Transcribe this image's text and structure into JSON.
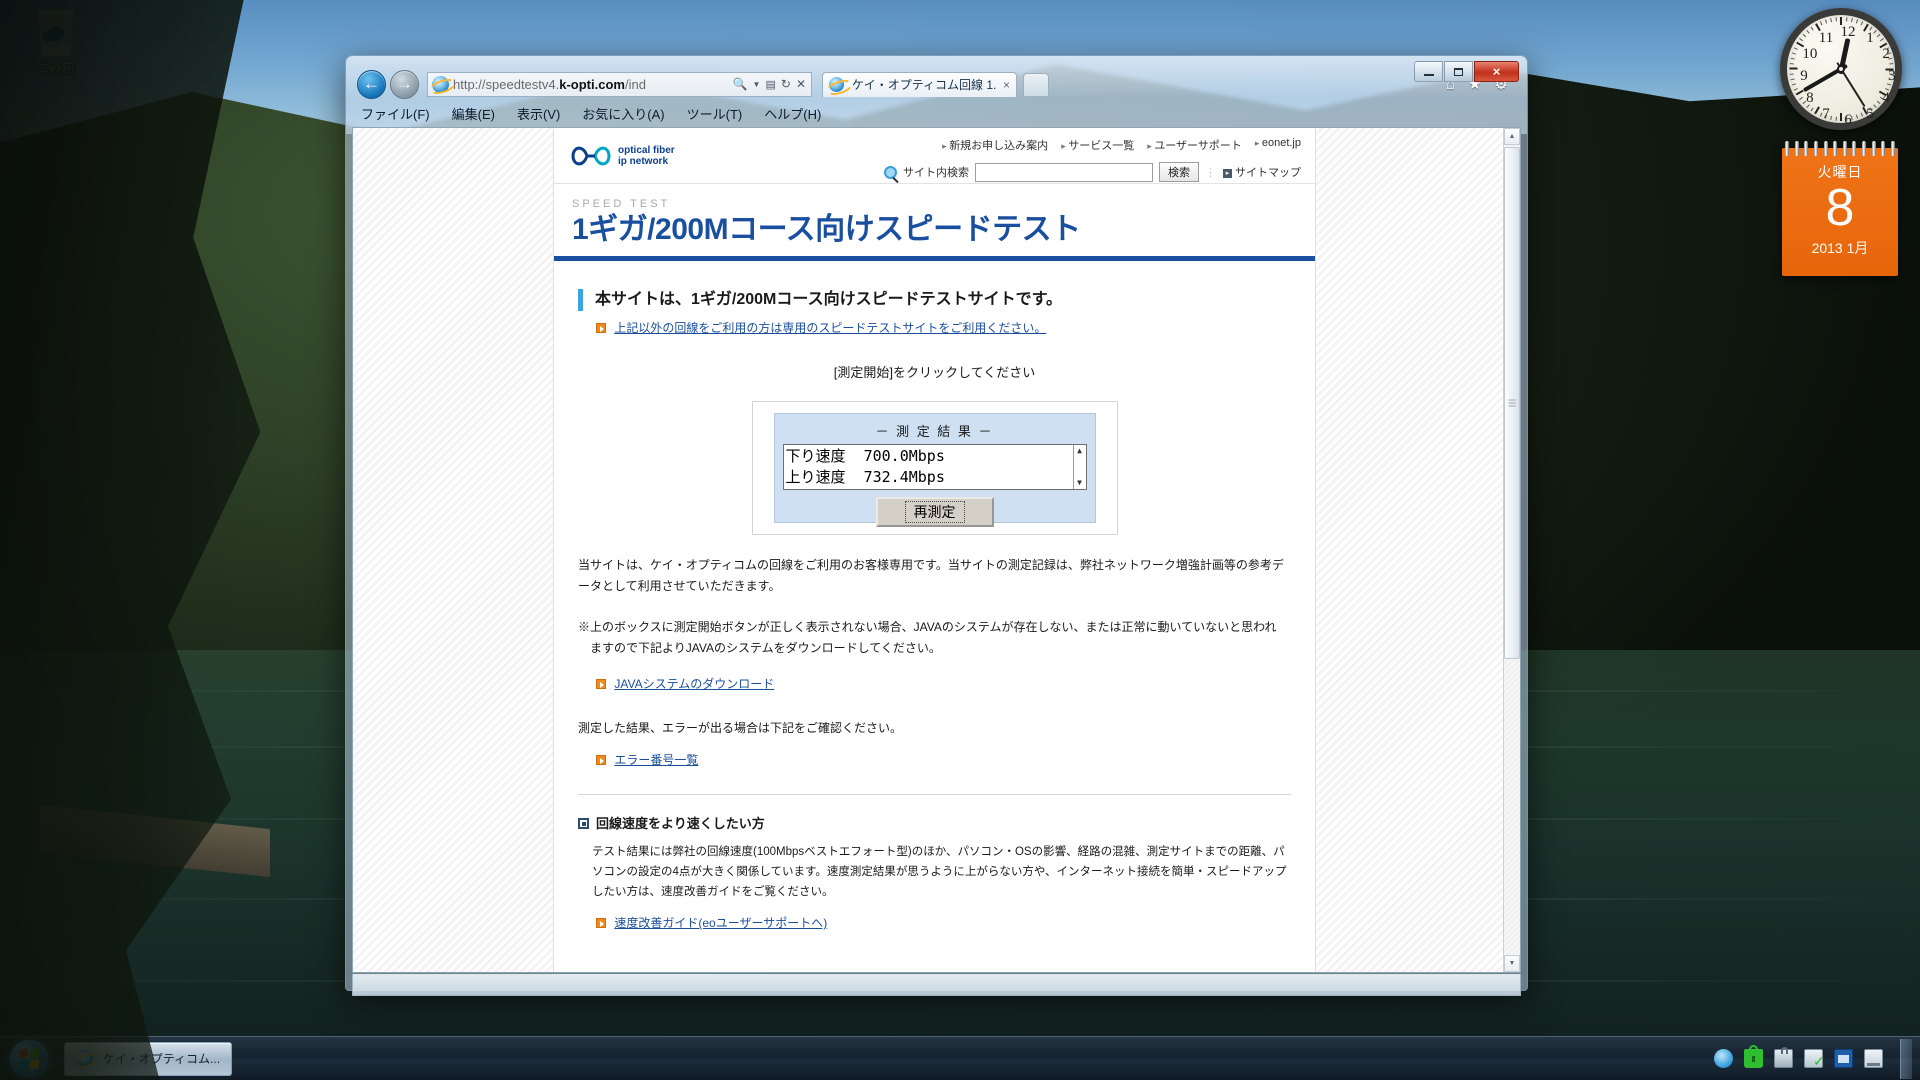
{
  "desktop": {
    "recycle_bin_label": "ごみ箱",
    "clock": {
      "numbers": [
        "12",
        "1",
        "2",
        "3",
        "4",
        "5",
        "6",
        "7",
        "8",
        "9",
        "10",
        "11"
      ],
      "hour_angle": 12,
      "minute_angle": 240,
      "second_angle": 148
    },
    "calendar": {
      "day_of_week": "火曜日",
      "day": "8",
      "month_year": "2013 1月"
    }
  },
  "window": {
    "minimize_label": "最小化",
    "maximize_label": "最大化",
    "close_label": "×",
    "back_label": "←",
    "forward_label": "→",
    "address": {
      "url_prefix": "http://speedtestv4.",
      "url_bold": "k-opti.com",
      "url_suffix": "/ind"
    },
    "address_icons": [
      "search-icon",
      "chevron-down-icon",
      "compat-view-icon",
      "refresh-icon",
      "stop-icon"
    ],
    "tab": {
      "title": "ケイ・オプティコム回線 1...",
      "close": "×"
    },
    "toolbar_icons": [
      "home-icon",
      "favorites-icon",
      "tools-icon"
    ],
    "menu": [
      "ファイル(F)",
      "編集(E)",
      "表示(V)",
      "お気に入り(A)",
      "ツール(T)",
      "ヘルプ(H)"
    ]
  },
  "site": {
    "logo_line1": "optical fiber",
    "logo_line2": "ip network",
    "top_links": [
      "新規お申し込み案内",
      "サービス一覧",
      "ユーザーサポート",
      "eonet.jp"
    ],
    "search_label": "サイト内検索",
    "search_value": "",
    "search_placeholder": "",
    "search_button": "検索",
    "sitemap": "サイトマップ"
  },
  "page": {
    "eyebrow": "SPEED TEST",
    "title": "1ギガ/200Mコース向けスピードテスト",
    "lead": "本サイトは、1ギガ/200Mコース向けスピードテストサイトです。",
    "lead_link": "上記以外の回線をご利用の方は専用のスピードテストサイトをご利用ください。",
    "click_note": "[測定開始]をクリックしてください",
    "applet": {
      "title": "－ 測 定 結 果 －",
      "results": [
        {
          "label": "下り速度",
          "value": "700.0Mbps"
        },
        {
          "label": "上り速度",
          "value": "732.4Mbps"
        }
      ],
      "button": "再測定",
      "scroll_up": "▲",
      "scroll_down": "▼"
    },
    "para1": "当サイトは、ケイ・オプティコムの回線をご利用のお客様専用です。当サイトの測定記録は、弊社ネットワーク増強計画等の参考データとして利用させていただきます。",
    "para2_line1": "※上のボックスに測定開始ボタンが正しく表示されない場合、JAVAのシステムが存在しない、または正常に動いていないと思われ",
    "para2_line2": "ますので下記よりJAVAのシステムをダウンロードしてください。",
    "java_link": "JAVAシステムのダウンロード",
    "para3": "測定した結果、エラーが出る場合は下記をご確認ください。",
    "error_link": "エラー番号一覧",
    "section_head": "回線速度をより速くしたい方",
    "section_body": "テスト結果には弊社の回線速度(100Mbpsベストエフォート型)のほか、パソコン・OSの影響、経路の混雑、測定サイトまでの距離、パソコンの設定の4点が大きく関係しています。速度測定結果が思うように上がらない方や、インターネット接続を簡単・スピードアップしたい方は、速度改善ガイドをご覧ください。",
    "section_link": "速度改善ガイド(eoユーザーサポートへ)"
  },
  "taskbar": {
    "start_label": "スタート",
    "task_button": "ケイ・オプティコム...",
    "tray_icons": [
      "action-center-icon",
      "security-icon",
      "update-icon",
      "printer-icon",
      "display-icon",
      "network-icon"
    ]
  },
  "colors": {
    "brand_blue": "#1a4fa0",
    "link_blue": "#1b4f9c",
    "accent_cyan": "#3aa6e0",
    "applet_bg": "#cfe0f2",
    "calendar_orange": "#ef7417"
  }
}
